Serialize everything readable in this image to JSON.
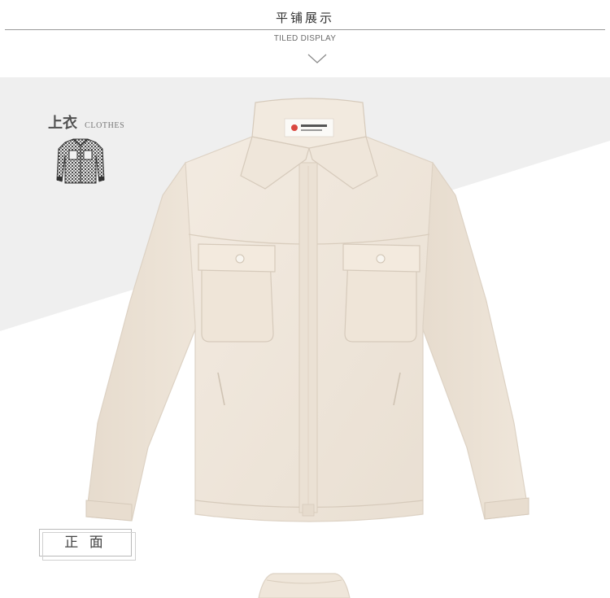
{
  "section": {
    "title": "平铺展示",
    "subtitle": "TILED DISPLAY",
    "divider_icon": "chevron-down-icon"
  },
  "category": {
    "title": "上衣",
    "subtitle": "CLOTHES",
    "thumbnail_icon": "shirt-pattern-icon"
  },
  "product": {
    "image": "jacket-front-image",
    "view_label": "正 面",
    "colors": {
      "fabric": "#efe6da",
      "panel_background": "#f1f1f1"
    }
  }
}
